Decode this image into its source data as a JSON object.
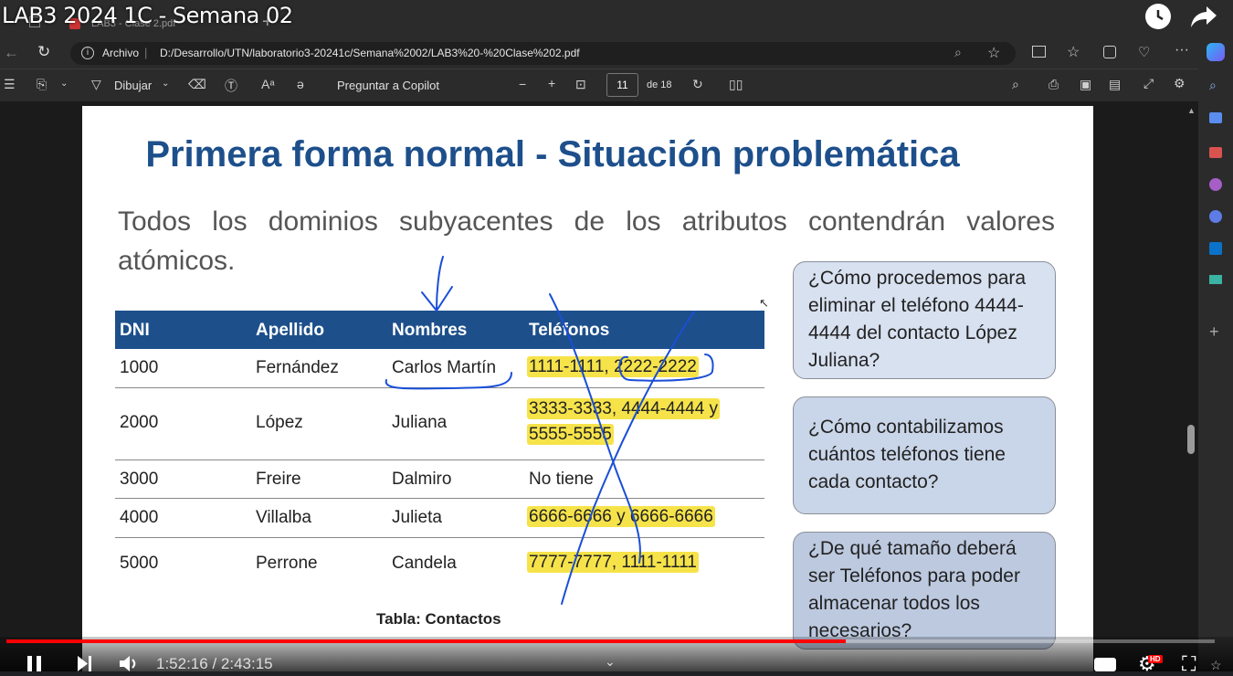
{
  "video": {
    "title": "LAB3 2024 1C - Semana 02",
    "time_current": "1:52:16",
    "time_separator": " / ",
    "time_total": "2:43:15",
    "progress_fraction": 0.695,
    "hd_badge": "HD"
  },
  "browser": {
    "tab_label": "LAB3 - Clase 2.pdf",
    "address_label": "Archivo",
    "address_sep": "|",
    "url": "D:/Desarrollo/UTN/laboratorio3-20241c/Semana%2002/LAB3%20-%20Clase%202.pdf"
  },
  "pdf_toolbar": {
    "draw_label": "Dibujar",
    "copilot_label": "Preguntar a Copilot",
    "zoom_out": "−",
    "zoom_in": "+",
    "page_current": "11",
    "page_total": "de 18"
  },
  "slide": {
    "title": "Primera forma normal - Situación problemática",
    "intro": "Todos los dominios subyacentes de los atributos contendrán valores atómicos.",
    "caption": "Tabla: Contactos",
    "headers": [
      "DNI",
      "Apellido",
      "Nombres",
      "Teléfonos"
    ],
    "rows": [
      {
        "dni": "1000",
        "apellido": "Fernández",
        "nombres": "Carlos Martín",
        "telefonos": "1111-1111, 2222-2222"
      },
      {
        "dni": "2000",
        "apellido": "López",
        "nombres": "Juliana",
        "telefonos": "3333-3333, 4444-4444 y 5555-5555"
      },
      {
        "dni": "3000",
        "apellido": "Freire",
        "nombres": "Dalmiro",
        "telefonos": "No tiene"
      },
      {
        "dni": "4000",
        "apellido": "Villalba",
        "nombres": "Julieta",
        "telefonos": "6666-6666 y 6666-6666"
      },
      {
        "dni": "5000",
        "apellido": "Perrone",
        "nombres": "Candela",
        "telefonos": "7777-7777, 1111-1111"
      }
    ],
    "questions": [
      "¿Cómo procedemos para eliminar el teléfono 4444-4444 del contacto López Juliana?",
      "¿Cómo contabilizamos cuántos teléfonos tiene cada contacto?",
      "¿De qué tamaño deberá ser Teléfonos para poder almacenar todos los necesarios?"
    ]
  },
  "colors": {
    "title_blue": "#1d4f8b",
    "header_blue": "#1d4f8b",
    "highlight": "#f6e34a",
    "ink": "#1a4fd6",
    "youtube_red": "#ff0000"
  }
}
